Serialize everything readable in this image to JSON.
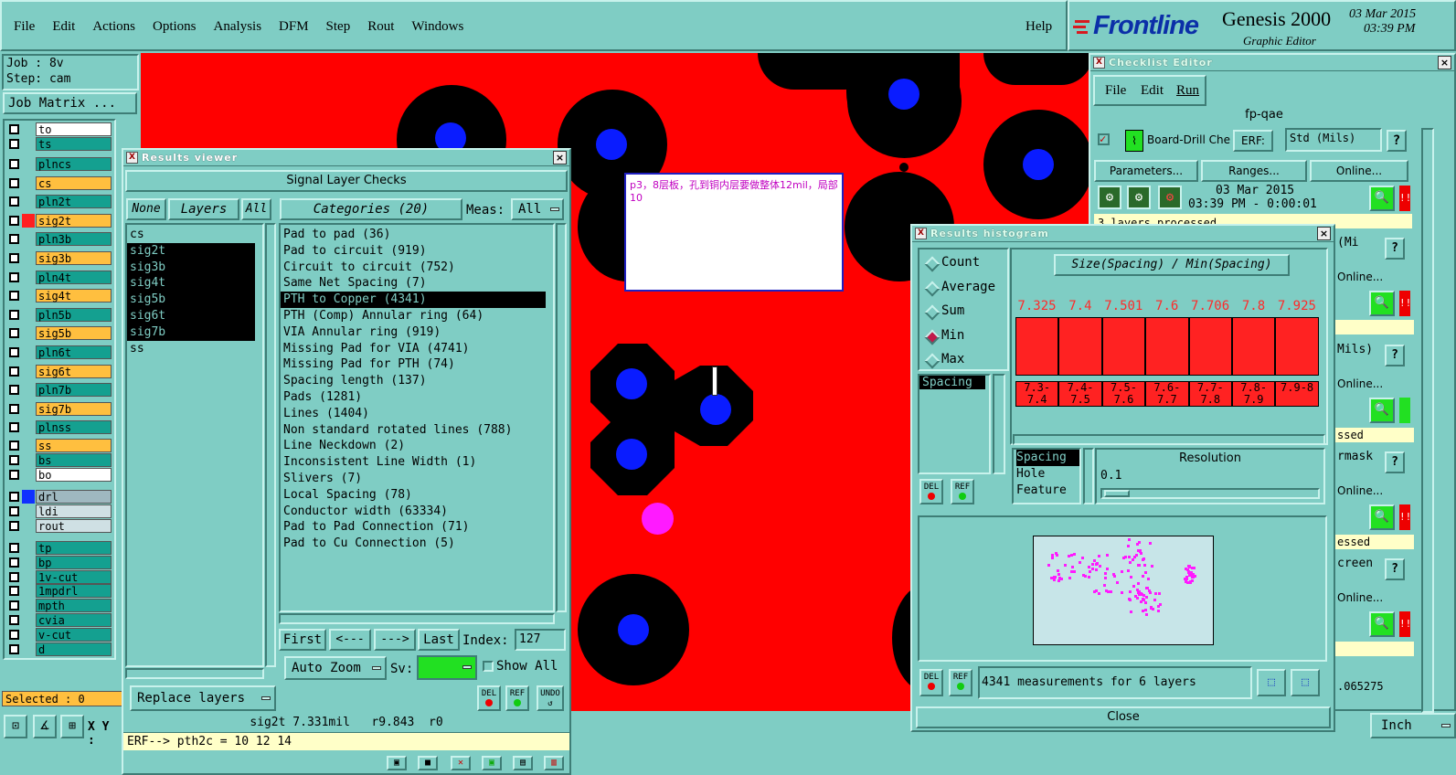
{
  "menubar": {
    "items": [
      "File",
      "Edit",
      "Actions",
      "Options",
      "Analysis",
      "DFM",
      "Step",
      "Rout",
      "Windows"
    ],
    "help": "Help"
  },
  "brand": {
    "logo": "Frontline",
    "product": "Genesis 2000",
    "subtitle": "Graphic Editor",
    "date": "03 Mar 2015",
    "time": "03:39 PM"
  },
  "job": {
    "job_line": "Job : 8v",
    "step_line": "Step: cam",
    "matrix_button": "Job Matrix ..."
  },
  "layers": [
    {
      "name": "to",
      "color": "#ffffff",
      "swatch": ""
    },
    {
      "name": "ts",
      "color": "#14a090",
      "swatch": ""
    },
    {
      "name": "plncs",
      "color": "#14a090",
      "swatch": ""
    },
    {
      "name": "cs",
      "color": "#ffbf3f",
      "swatch": ""
    },
    {
      "name": "pln2t",
      "color": "#14a090",
      "swatch": ""
    },
    {
      "name": "sig2t",
      "color": "#ffbf3f",
      "swatch": "#ff2020"
    },
    {
      "name": "pln3b",
      "color": "#14a090",
      "swatch": ""
    },
    {
      "name": "sig3b",
      "color": "#ffbf3f",
      "swatch": ""
    },
    {
      "name": "pln4t",
      "color": "#14a090",
      "swatch": ""
    },
    {
      "name": "sig4t",
      "color": "#ffbf3f",
      "swatch": ""
    },
    {
      "name": "pln5b",
      "color": "#14a090",
      "swatch": ""
    },
    {
      "name": "sig5b",
      "color": "#ffbf3f",
      "swatch": ""
    },
    {
      "name": "pln6t",
      "color": "#14a090",
      "swatch": ""
    },
    {
      "name": "sig6t",
      "color": "#ffbf3f",
      "swatch": ""
    },
    {
      "name": "pln7b",
      "color": "#14a090",
      "swatch": ""
    },
    {
      "name": "sig7b",
      "color": "#ffbf3f",
      "swatch": ""
    },
    {
      "name": "plnss",
      "color": "#14a090",
      "swatch": ""
    },
    {
      "name": "ss",
      "color": "#ffbf3f",
      "swatch": ""
    },
    {
      "name": "bs",
      "color": "#14a090",
      "swatch": ""
    },
    {
      "name": "bo",
      "color": "#ffffff",
      "swatch": ""
    },
    {
      "name": "drl",
      "color": "#9fb8c0",
      "swatch": "#1030ff"
    },
    {
      "name": "ldi",
      "color": "#cfe0e4",
      "swatch": ""
    },
    {
      "name": "rout",
      "color": "#cfe0e4",
      "swatch": ""
    },
    {
      "name": "tp",
      "color": "#14a090",
      "swatch": ""
    },
    {
      "name": "bp",
      "color": "#14a090",
      "swatch": ""
    },
    {
      "name": "1v-cut",
      "color": "#14a090",
      "swatch": ""
    },
    {
      "name": "1mpdrl",
      "color": "#14a090",
      "swatch": ""
    },
    {
      "name": "mpth",
      "color": "#14a090",
      "swatch": ""
    },
    {
      "name": "cvia",
      "color": "#14a090",
      "swatch": ""
    },
    {
      "name": "v-cut",
      "color": "#14a090",
      "swatch": ""
    },
    {
      "name": "d",
      "color": "#14a090",
      "swatch": ""
    }
  ],
  "selected": "Selected : 0",
  "coord_label": "X Y :",
  "note": "p3，8层板，孔到铜内层要做整体12mil，局部10",
  "results_viewer": {
    "title": "Results viewer",
    "header": "Signal Layer Checks",
    "btn_none": "None",
    "btn_layers": "Layers",
    "btn_all": "All",
    "categories_label": "Categories (20)",
    "meas_label": "Meas:",
    "meas_value": "All",
    "layers": [
      "cs",
      "sig2t",
      "sig3b",
      "sig4t",
      "sig5b",
      "sig6t",
      "sig7b",
      "ss"
    ],
    "categories": [
      "Pad to pad (36)",
      "Pad to circuit (919)",
      "Circuit to circuit (752)",
      "Same Net Spacing (7)",
      "PTH to Copper (4341)",
      "PTH (Comp) Annular ring (64)",
      "VIA Annular ring (919)",
      "Missing Pad for VIA (4741)",
      "Missing Pad for PTH (74)",
      "Spacing length (137)",
      "Pads (1281)",
      "Lines (1404)",
      "Non standard rotated lines (788)",
      "Line Neckdown (2)",
      "Inconsistent Line Width (1)",
      "Slivers (7)",
      "Local Spacing (78)",
      "Conductor width (63334)",
      "Pad to Pad Connection (71)",
      "Pad to Cu Connection (5)"
    ],
    "first": "First",
    "prev": "<---",
    "next": "--->",
    "last": "Last",
    "index_label": "Index:",
    "index_value": "127",
    "auto_zoom": "Auto Zoom",
    "sv_label": "Sv:",
    "show_all": "Show All",
    "replace_layers": "Replace layers",
    "del": "DEL",
    "ref": "REF",
    "undo": "UNDO",
    "status_line": "sig2t 7.331mil   r9.843  r0",
    "erf_line": "ERF--> pth2c = 10 12 14"
  },
  "checklist": {
    "title": "Checklist Editor",
    "menu": [
      "File",
      "Edit",
      "Run"
    ],
    "name": "fp-qae",
    "action_name": "Board-Drill Che",
    "erf_label": "ERF:",
    "erf_value": "Std (Mils)",
    "parameters": "Parameters...",
    "ranges": "Ranges...",
    "online": "Online...",
    "date": "03 Mar 2015",
    "time_line": "03:39 PM - 0:00:01",
    "processed": "3 layers processed",
    "partial": [
      "(Mi",
      "Online...",
      "Mils)",
      "Online...",
      "ssed",
      "rmask",
      "Online...",
      "essed",
      "creen",
      "Online...",
      ".065275"
    ],
    "help": "?",
    "inch": "Inch"
  },
  "histogram": {
    "title": "Results histogram",
    "modes": [
      "Count",
      "Average",
      "Sum",
      "Min",
      "Max"
    ],
    "selected_mode": "Min",
    "chart_title": "Size(Spacing) / Min(Spacing)",
    "list_items": [
      "Spacing"
    ],
    "attr_items": [
      "Spacing",
      "Hole",
      "Feature"
    ],
    "resolution_label": "Resolution",
    "resolution_value": "0.1",
    "summary": "4341 measurements for 6 layers",
    "close": "Close",
    "del": "DEL",
    "ref": "REF"
  },
  "chart_data": {
    "type": "bar",
    "title": "Size(Spacing) / Min(Spacing)",
    "categories": [
      "7.3-7.4",
      "7.4-7.5",
      "7.5-7.6",
      "7.6-7.7",
      "7.7-7.8",
      "7.8-7.9",
      "7.9-8"
    ],
    "values": [
      7.325,
      7.4,
      7.501,
      7.6,
      7.706,
      7.8,
      7.925
    ],
    "labels": [
      "7.325",
      "7.4",
      "7.501",
      "7.6",
      "7.706",
      "7.8",
      "7.925"
    ],
    "colors": {
      "bar": "#ff2222",
      "label": "#ff2a2a"
    }
  },
  "colors": {
    "panel": "#7fcdc4",
    "canvas_red": "#ff0000",
    "pad_blue": "#0a1cff",
    "black": "#000000",
    "magenta": "#ff1aff"
  }
}
